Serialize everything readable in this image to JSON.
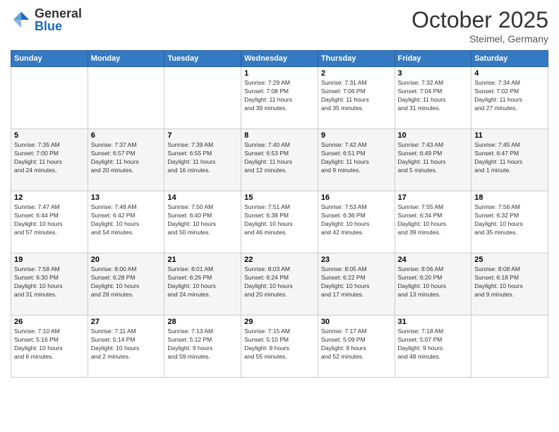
{
  "header": {
    "logo": {
      "general": "General",
      "blue": "Blue"
    },
    "title": "October 2025",
    "location": "Steimel, Germany"
  },
  "weekdays": [
    "Sunday",
    "Monday",
    "Tuesday",
    "Wednesday",
    "Thursday",
    "Friday",
    "Saturday"
  ],
  "weeks": [
    [
      {
        "day": "",
        "info": ""
      },
      {
        "day": "",
        "info": ""
      },
      {
        "day": "",
        "info": ""
      },
      {
        "day": "1",
        "info": "Sunrise: 7:29 AM\nSunset: 7:08 PM\nDaylight: 11 hours\nand 39 minutes."
      },
      {
        "day": "2",
        "info": "Sunrise: 7:31 AM\nSunset: 7:06 PM\nDaylight: 11 hours\nand 35 minutes."
      },
      {
        "day": "3",
        "info": "Sunrise: 7:32 AM\nSunset: 7:04 PM\nDaylight: 11 hours\nand 31 minutes."
      },
      {
        "day": "4",
        "info": "Sunrise: 7:34 AM\nSunset: 7:02 PM\nDaylight: 11 hours\nand 27 minutes."
      }
    ],
    [
      {
        "day": "5",
        "info": "Sunrise: 7:35 AM\nSunset: 7:00 PM\nDaylight: 11 hours\nand 24 minutes."
      },
      {
        "day": "6",
        "info": "Sunrise: 7:37 AM\nSunset: 6:57 PM\nDaylight: 11 hours\nand 20 minutes."
      },
      {
        "day": "7",
        "info": "Sunrise: 7:39 AM\nSunset: 6:55 PM\nDaylight: 11 hours\nand 16 minutes."
      },
      {
        "day": "8",
        "info": "Sunrise: 7:40 AM\nSunset: 6:53 PM\nDaylight: 11 hours\nand 12 minutes."
      },
      {
        "day": "9",
        "info": "Sunrise: 7:42 AM\nSunset: 6:51 PM\nDaylight: 11 hours\nand 9 minutes."
      },
      {
        "day": "10",
        "info": "Sunrise: 7:43 AM\nSunset: 6:49 PM\nDaylight: 11 hours\nand 5 minutes."
      },
      {
        "day": "11",
        "info": "Sunrise: 7:45 AM\nSunset: 6:47 PM\nDaylight: 11 hours\nand 1 minute."
      }
    ],
    [
      {
        "day": "12",
        "info": "Sunrise: 7:47 AM\nSunset: 6:44 PM\nDaylight: 10 hours\nand 57 minutes."
      },
      {
        "day": "13",
        "info": "Sunrise: 7:48 AM\nSunset: 6:42 PM\nDaylight: 10 hours\nand 54 minutes."
      },
      {
        "day": "14",
        "info": "Sunrise: 7:50 AM\nSunset: 6:40 PM\nDaylight: 10 hours\nand 50 minutes."
      },
      {
        "day": "15",
        "info": "Sunrise: 7:51 AM\nSunset: 6:38 PM\nDaylight: 10 hours\nand 46 minutes."
      },
      {
        "day": "16",
        "info": "Sunrise: 7:53 AM\nSunset: 6:36 PM\nDaylight: 10 hours\nand 42 minutes."
      },
      {
        "day": "17",
        "info": "Sunrise: 7:55 AM\nSunset: 6:34 PM\nDaylight: 10 hours\nand 39 minutes."
      },
      {
        "day": "18",
        "info": "Sunrise: 7:56 AM\nSunset: 6:32 PM\nDaylight: 10 hours\nand 35 minutes."
      }
    ],
    [
      {
        "day": "19",
        "info": "Sunrise: 7:58 AM\nSunset: 6:30 PM\nDaylight: 10 hours\nand 31 minutes."
      },
      {
        "day": "20",
        "info": "Sunrise: 8:00 AM\nSunset: 6:28 PM\nDaylight: 10 hours\nand 28 minutes."
      },
      {
        "day": "21",
        "info": "Sunrise: 8:01 AM\nSunset: 6:26 PM\nDaylight: 10 hours\nand 24 minutes."
      },
      {
        "day": "22",
        "info": "Sunrise: 8:03 AM\nSunset: 6:24 PM\nDaylight: 10 hours\nand 20 minutes."
      },
      {
        "day": "23",
        "info": "Sunrise: 8:05 AM\nSunset: 6:22 PM\nDaylight: 10 hours\nand 17 minutes."
      },
      {
        "day": "24",
        "info": "Sunrise: 8:06 AM\nSunset: 6:20 PM\nDaylight: 10 hours\nand 13 minutes."
      },
      {
        "day": "25",
        "info": "Sunrise: 8:08 AM\nSunset: 6:18 PM\nDaylight: 10 hours\nand 9 minutes."
      }
    ],
    [
      {
        "day": "26",
        "info": "Sunrise: 7:10 AM\nSunset: 5:16 PM\nDaylight: 10 hours\nand 6 minutes."
      },
      {
        "day": "27",
        "info": "Sunrise: 7:11 AM\nSunset: 5:14 PM\nDaylight: 10 hours\nand 2 minutes."
      },
      {
        "day": "28",
        "info": "Sunrise: 7:13 AM\nSunset: 5:12 PM\nDaylight: 9 hours\nand 59 minutes."
      },
      {
        "day": "29",
        "info": "Sunrise: 7:15 AM\nSunset: 5:10 PM\nDaylight: 9 hours\nand 55 minutes."
      },
      {
        "day": "30",
        "info": "Sunrise: 7:17 AM\nSunset: 5:09 PM\nDaylight: 9 hours\nand 52 minutes."
      },
      {
        "day": "31",
        "info": "Sunrise: 7:18 AM\nSunset: 5:07 PM\nDaylight: 9 hours\nand 48 minutes."
      },
      {
        "day": "",
        "info": ""
      }
    ]
  ]
}
